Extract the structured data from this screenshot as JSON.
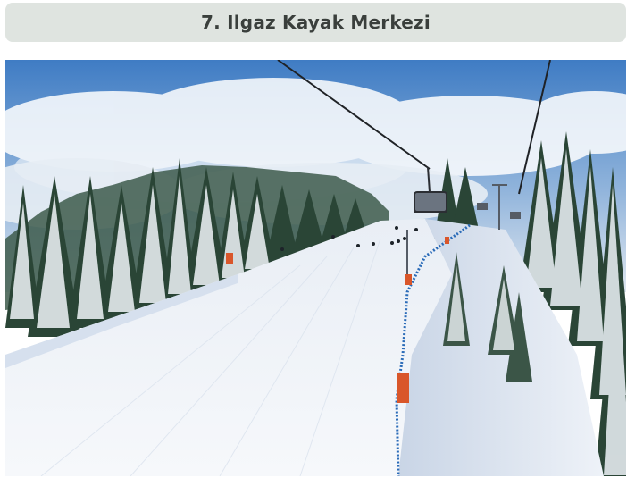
{
  "heading": {
    "title": "7. Ilgaz Kayak Merkezi"
  },
  "photo": {
    "subject": "ski-slope-photo",
    "sky_color": "#4d86c9",
    "snow_color": "#f1f4f8",
    "tree_color": "#2f4a3c",
    "pole_marker_color": "#d9562a",
    "fence_color": "#2a6bb8"
  }
}
